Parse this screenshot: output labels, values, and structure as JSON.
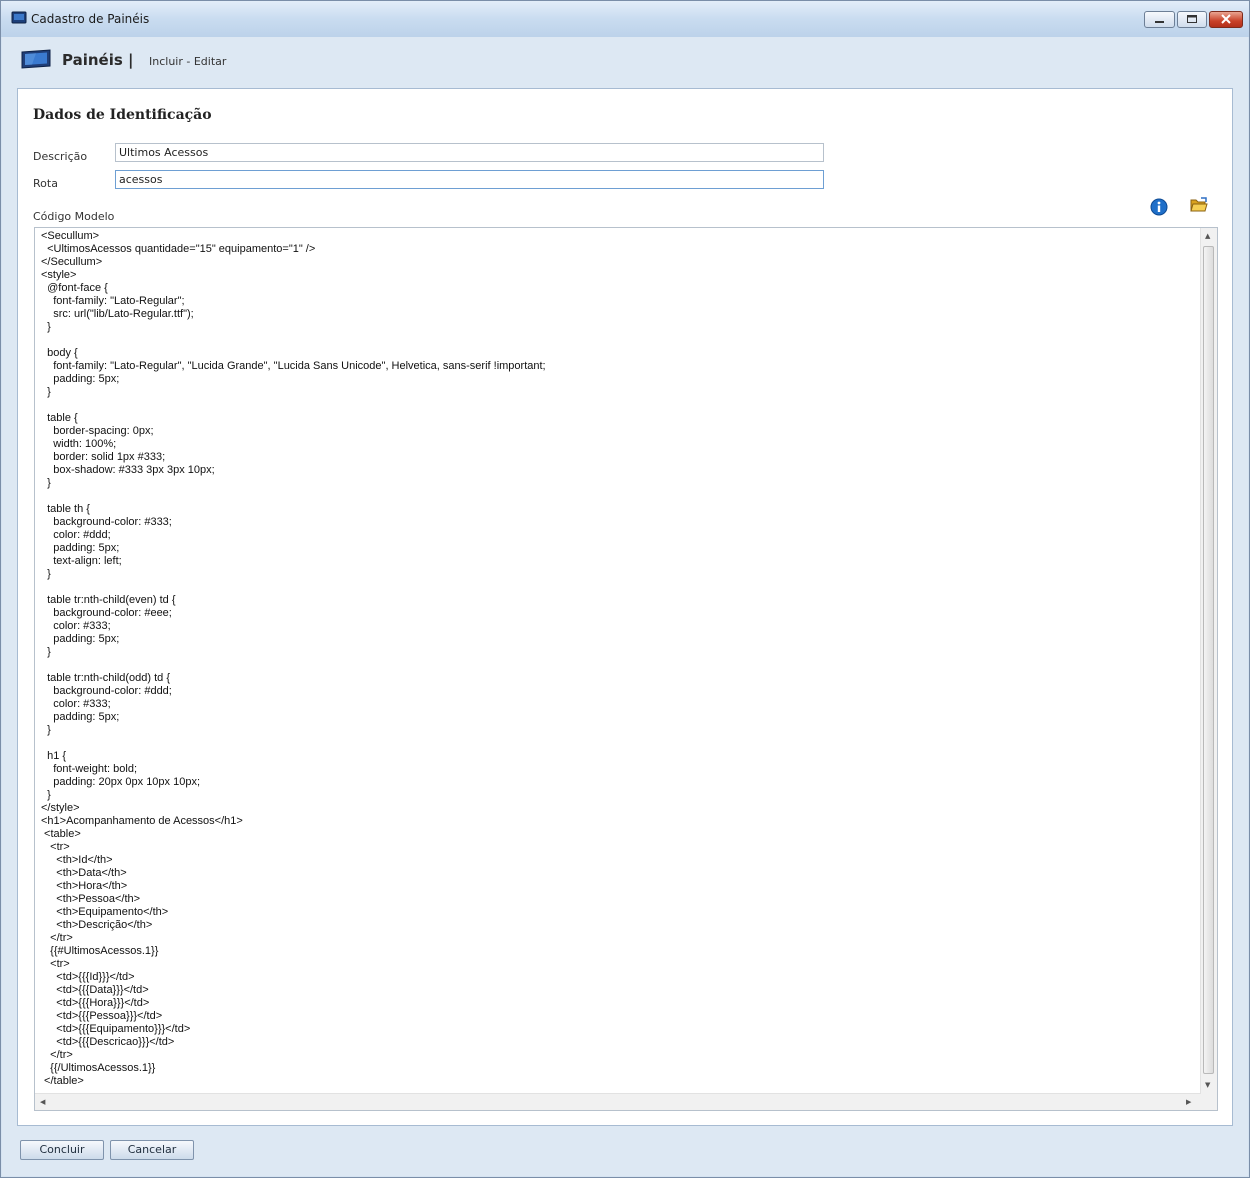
{
  "window": {
    "title": "Cadastro de Painéis",
    "controls": [
      "minimize",
      "maximize",
      "close"
    ]
  },
  "header": {
    "title": "Painéis |",
    "subtitle": "Incluir - Editar",
    "icon": "monitor-icon"
  },
  "form": {
    "section_title": "Dados de Identificação",
    "descricao_label": "Descrição",
    "descricao_value": "Ultimos Acessos",
    "rota_label": "Rota",
    "rota_value": "acessos",
    "codigo_label": "Código Modelo",
    "icons": [
      "info-icon",
      "open-folder-icon"
    ],
    "code": "<Secullum>\n  <UltimosAcessos quantidade=\"15\" equipamento=\"1\" />\n</Secullum>\n<style>\n  @font-face {\n    font-family: \"Lato-Regular\";\n    src: url(\"lib/Lato-Regular.ttf\");\n  }\n\n  body {\n    font-family: \"Lato-Regular\", \"Lucida Grande\", \"Lucida Sans Unicode\", Helvetica, sans-serif !important;\n    padding: 5px;\n  }\n\n  table {\n    border-spacing: 0px;\n    width: 100%;\n    border: solid 1px #333;\n    box-shadow: #333 3px 3px 10px;\n  }\n\n  table th {\n    background-color: #333;\n    color: #ddd;\n    padding: 5px;\n    text-align: left;\n  }\n\n  table tr:nth-child(even) td {\n    background-color: #eee;\n    color: #333;\n    padding: 5px;\n  }\n\n  table tr:nth-child(odd) td {\n    background-color: #ddd;\n    color: #333;\n    padding: 5px;\n  }\n\n  h1 {\n    font-weight: bold;\n    padding: 20px 0px 10px 10px;\n  }\n</style>\n<h1>Acompanhamento de Acessos</h1>\n <table>\n   <tr>\n     <th>Id</th>\n     <th>Data</th>\n     <th>Hora</th>\n     <th>Pessoa</th>\n     <th>Equipamento</th>\n     <th>Descrição</th>\n   </tr>\n   {{#UltimosAcessos.1}}\n   <tr>\n     <td>{{{Id}}}</td>\n     <td>{{{Data}}}</td>\n     <td>{{{Hora}}}</td>\n     <td>{{{Pessoa}}}</td>\n     <td>{{{Equipamento}}}</td>\n     <td>{{{Descricao}}}</td>\n   </tr>\n   {{/UltimosAcessos.1}}\n </table>"
  },
  "footer": {
    "concluir_label": "Concluir",
    "cancelar_label": "Cancelar"
  },
  "colors": {
    "window_bg": "#dde8f3",
    "accent": "#1f6fc9",
    "close_button": "#c94128"
  }
}
